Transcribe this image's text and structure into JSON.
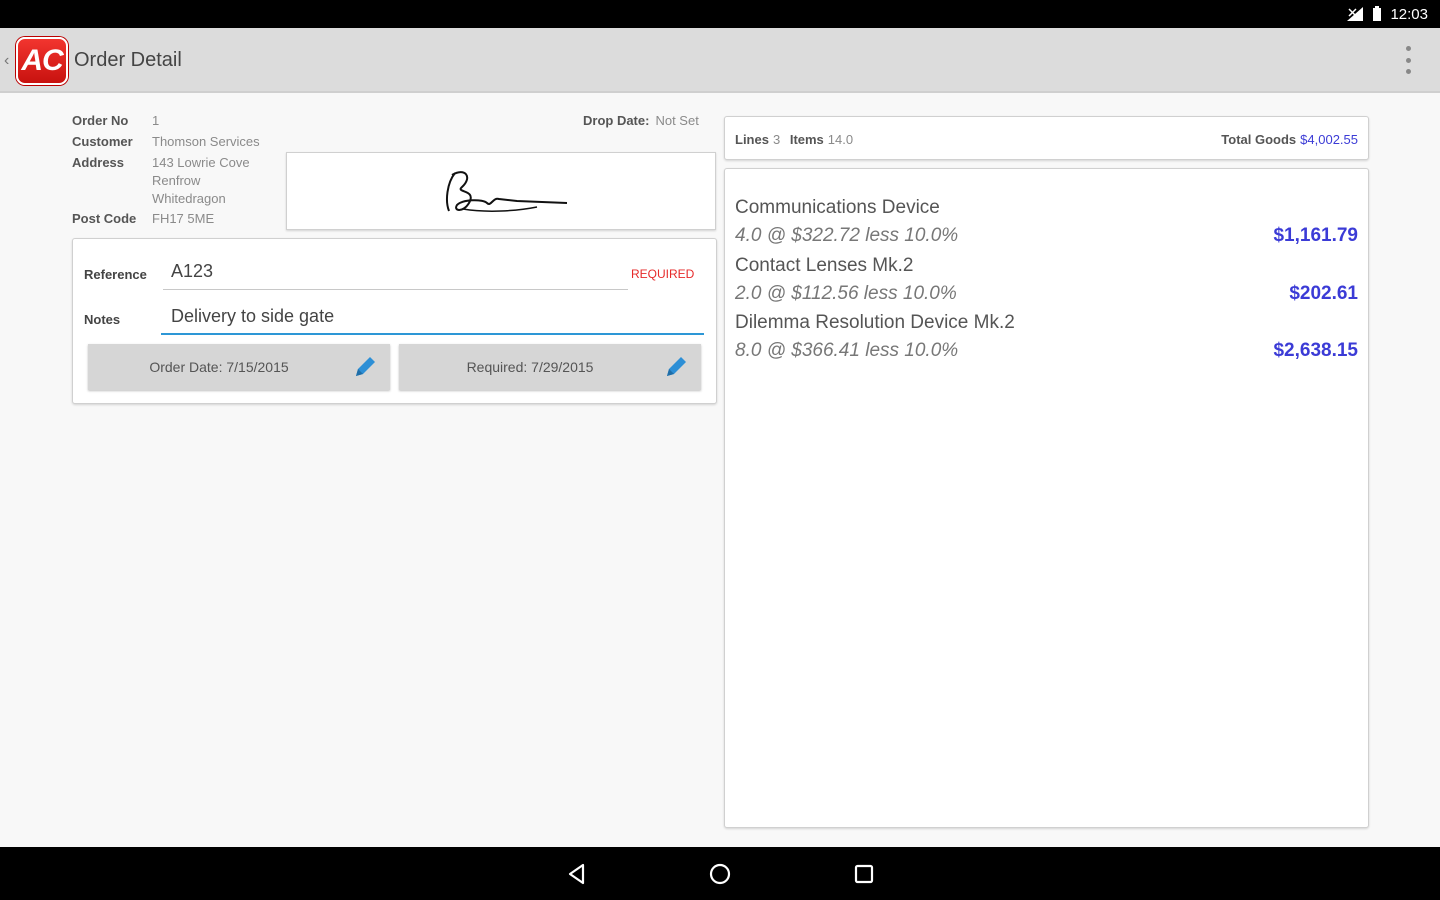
{
  "status_bar": {
    "time": "12:03"
  },
  "app_bar": {
    "logo_text": "AC",
    "title": "Order Detail"
  },
  "order": {
    "order_no_label": "Order No",
    "order_no": "1",
    "customer_label": "Customer",
    "customer": "Thomson Services",
    "address_label": "Address",
    "address_lines": [
      "143 Lowrie Cove",
      "Renfrow",
      "Whitedragon"
    ],
    "post_code_label": "Post Code",
    "post_code": "FH17 5ME",
    "drop_date_label": "Drop Date:",
    "drop_date": "Not Set"
  },
  "form": {
    "reference_label": "Reference",
    "reference_value": "A123",
    "required_text": "REQUIRED",
    "notes_label": "Notes",
    "notes_value": "Delivery to side gate",
    "order_date_button": "Order Date: 7/15/2015",
    "required_date_button": "Required: 7/29/2015"
  },
  "totals": {
    "lines_label": "Lines",
    "lines": "3",
    "items_label": "Items",
    "items": "14.0",
    "total_goods_label": "Total Goods",
    "total_goods": "$4,002.55"
  },
  "line_items": [
    {
      "name": "Communications Device",
      "detail": "4.0 @ $322.72 less 10.0%",
      "price": "$1,161.79"
    },
    {
      "name": "Contact Lenses Mk.2",
      "detail": "2.0 @ $112.56 less 10.0%",
      "price": "$202.61"
    },
    {
      "name": "Dilemma Resolution Device Mk.2",
      "detail": "8.0 @ $366.41 less 10.0%",
      "price": "$2,638.15"
    }
  ],
  "icons": {
    "back": "chevron-left-icon",
    "overflow": "more-vert-icon",
    "edit": "pencil-icon",
    "nav_back": "triangle-back-icon",
    "nav_home": "circle-home-icon",
    "nav_recents": "square-recents-icon"
  },
  "colors": {
    "accent_blue": "#3b3bd6",
    "required_red": "#e62a2a",
    "input_focus": "#2d97d6",
    "logo_red": "#e02620"
  }
}
